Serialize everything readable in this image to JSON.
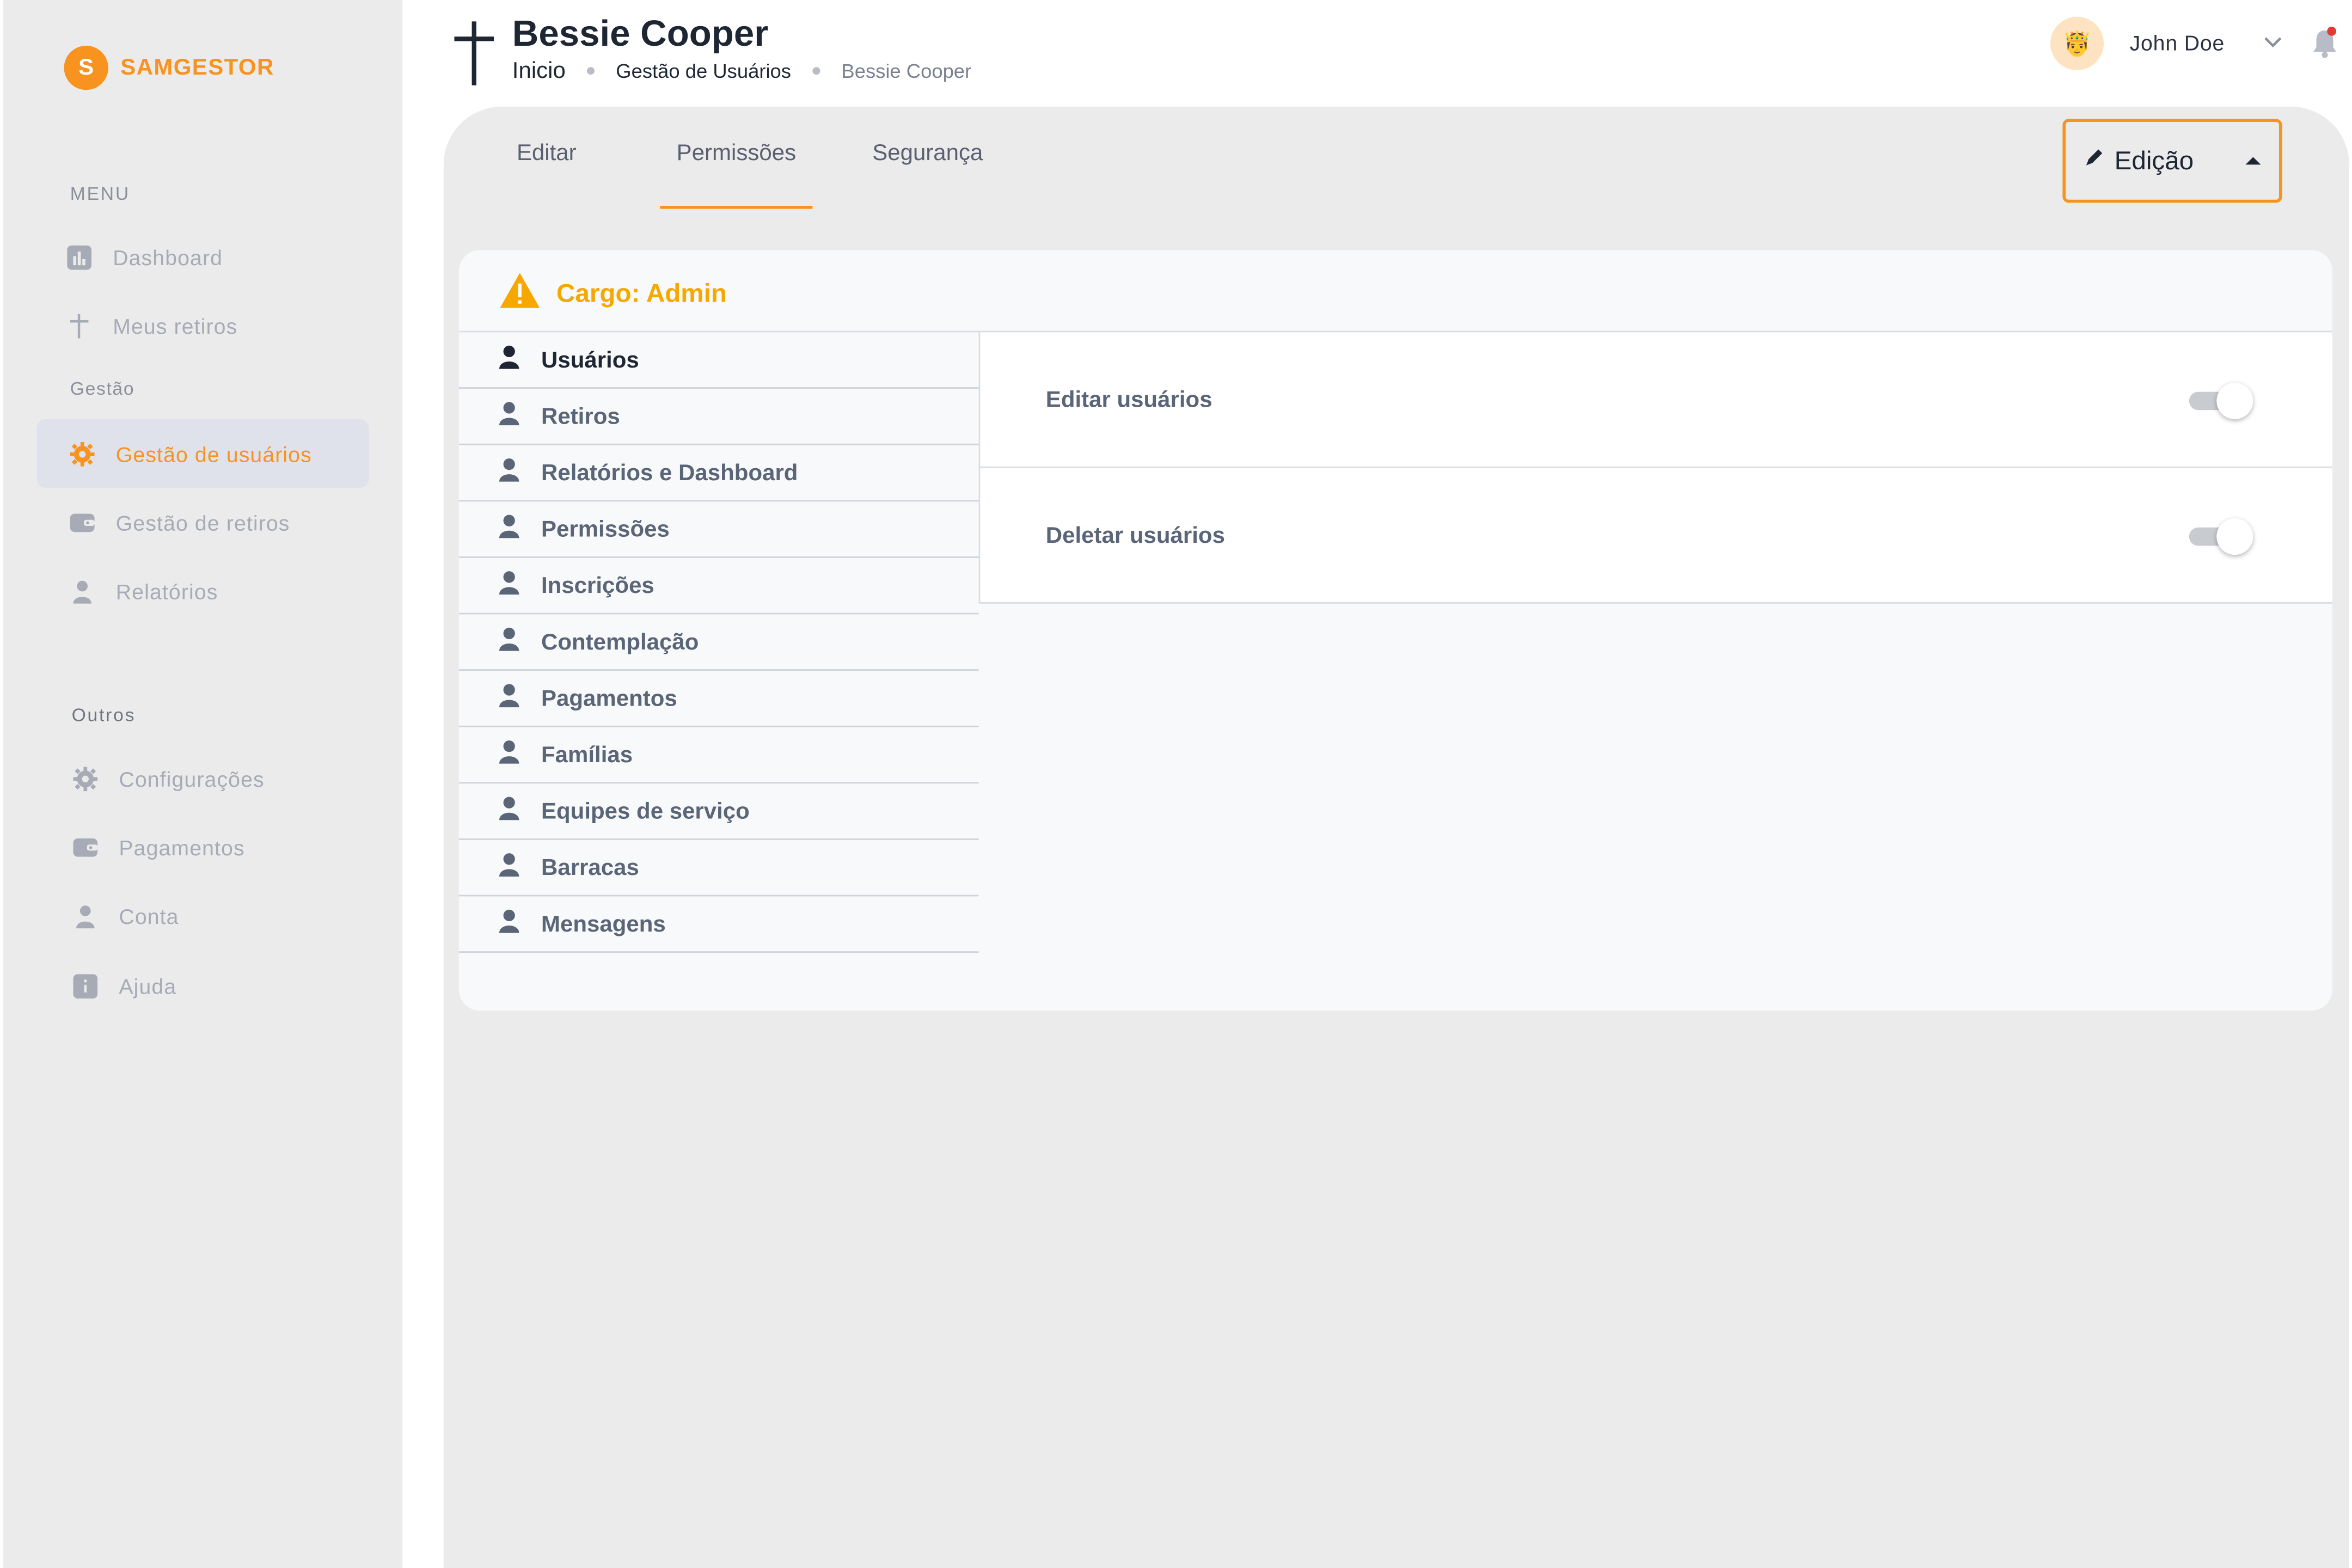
{
  "brand": {
    "logo_letter": "S",
    "name": "SAMGESTOR",
    "accent": "#f7931e"
  },
  "sidebar": {
    "menu_label": "MENU",
    "menu_items": [
      {
        "label": "Dashboard",
        "icon": "chart-icon"
      },
      {
        "label": "Meus retiros",
        "icon": "cross-icon"
      }
    ],
    "gestao_label": "Gestão",
    "gestao_items": [
      {
        "label": "Gestão de usuários",
        "icon": "gear-icon",
        "active": true
      },
      {
        "label": "Gestão de retiros",
        "icon": "wallet-icon"
      },
      {
        "label": "Relatórios",
        "icon": "user-icon"
      }
    ],
    "outros_label": "Outros",
    "outros_items": [
      {
        "label": "Configurações",
        "icon": "gear-icon"
      },
      {
        "label": "Pagamentos",
        "icon": "wallet-icon"
      },
      {
        "label": "Conta",
        "icon": "user-icon"
      },
      {
        "label": "Ajuda",
        "icon": "info-icon"
      }
    ]
  },
  "header": {
    "title": "Bessie Cooper",
    "breadcrumb": {
      "home": "Inicio",
      "section": "Gestão de Usuários",
      "current": "Bessie Cooper"
    },
    "user": {
      "name": "John Doe",
      "avatar": "🤴"
    }
  },
  "tabs": [
    {
      "label": "Editar"
    },
    {
      "label": "Permissões",
      "active": true
    },
    {
      "label": "Segurança"
    }
  ],
  "mode_select": {
    "selected": "Edição",
    "icon": "pencil-icon"
  },
  "role": {
    "title": "Cargo: Admin",
    "icon": "warning-icon",
    "color": "#f7a800"
  },
  "permission_modules": [
    "Usuários",
    "Retiros",
    "Relatórios e Dashboard",
    "Permissões",
    "Inscrições",
    "Contemplação",
    "Pagamentos",
    "Famílias",
    "Equipes de serviço",
    "Barracas",
    "Mensagens"
  ],
  "active_module": "Usuários",
  "permissions": [
    {
      "label": "Editar usuários",
      "enabled": false
    },
    {
      "label": "Deletar usuários",
      "enabled": false
    }
  ]
}
